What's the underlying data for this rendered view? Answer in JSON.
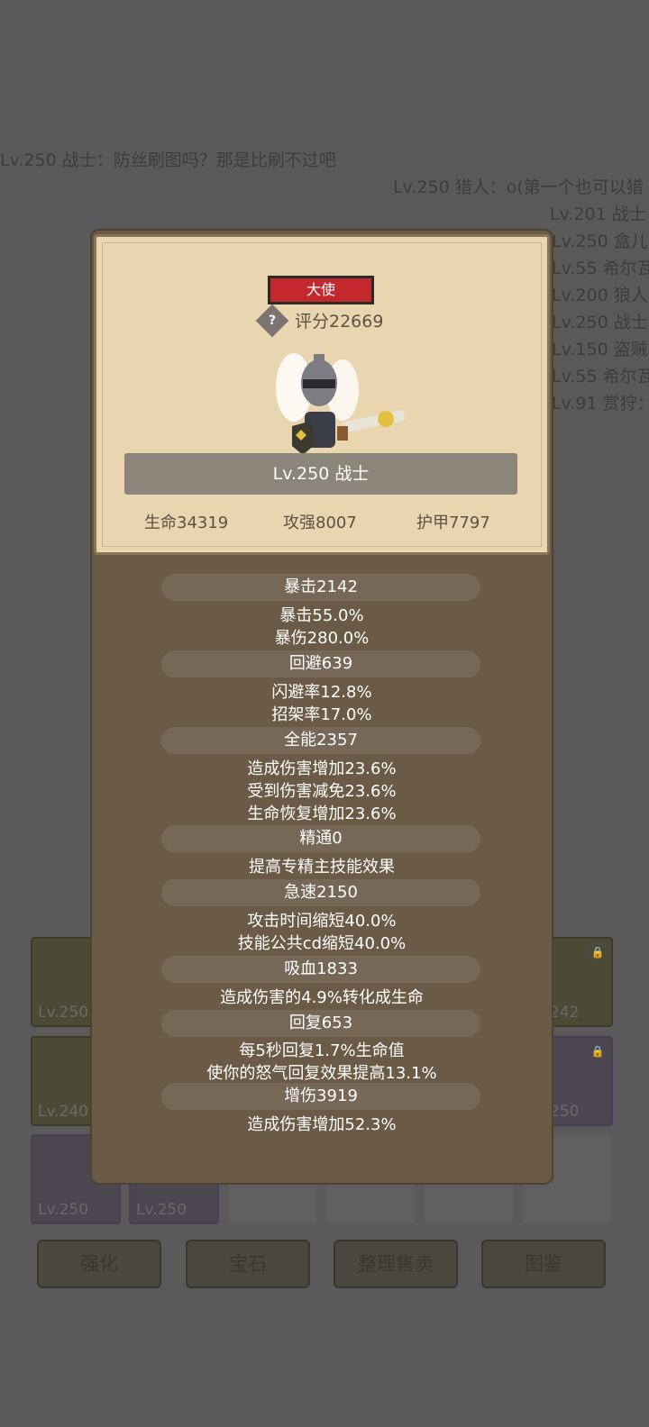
{
  "chat": [
    "Lv.250 战士：防丝刷图吗？那是比刷不过吧",
    "Lv.250 猎人：o(第一个也可以猎",
    "Lv.201 战士",
    "Lv.250 盒儿",
    "Lv.55 希尔瓦",
    "Lv.200 狼人",
    "Lv.250 战士",
    "Lv.150 盗贼",
    "Lv.55 希尔瓦",
    "Lv.91 赏狩："
  ],
  "inventory": {
    "row1": [
      "Lv.250",
      "242"
    ],
    "row2": [
      "Lv.240",
      "250"
    ],
    "row3": [
      "Lv.250",
      "Lv.250"
    ]
  },
  "bottom_buttons": [
    "强化",
    "宝石",
    "整理售卖",
    "图鉴"
  ],
  "profile": {
    "title_badge": "大使",
    "help_icon": "?",
    "score": "评分22669",
    "name": "Lv.250 战士",
    "hp": "生命34319",
    "attack": "攻强8007",
    "armor": "护甲7797"
  },
  "stats": [
    {
      "header": "暴击2142",
      "lines": [
        "暴击55.0%",
        "暴伤280.0%"
      ]
    },
    {
      "header": "回避639",
      "lines": [
        "闪避率12.8%",
        "招架率17.0%"
      ]
    },
    {
      "header": "全能2357",
      "lines": [
        "造成伤害增加23.6%",
        "受到伤害减免23.6%",
        "生命恢复增加23.6%"
      ]
    },
    {
      "header": "精通0",
      "lines": [
        "提高专精主技能效果"
      ]
    },
    {
      "header": "急速2150",
      "lines": [
        "攻击时间缩短40.0%",
        "技能公共cd缩短40.0%"
      ]
    },
    {
      "header": "吸血1833",
      "lines": [
        "造成伤害的4.9%转化成生命"
      ]
    },
    {
      "header": "回复653",
      "lines": [
        "每5秒回复1.7%生命值",
        "使你的怒气回复效果提高13.1%"
      ]
    },
    {
      "header": "增伤3919",
      "lines": [
        "造成伤害增加52.3%"
      ]
    }
  ]
}
